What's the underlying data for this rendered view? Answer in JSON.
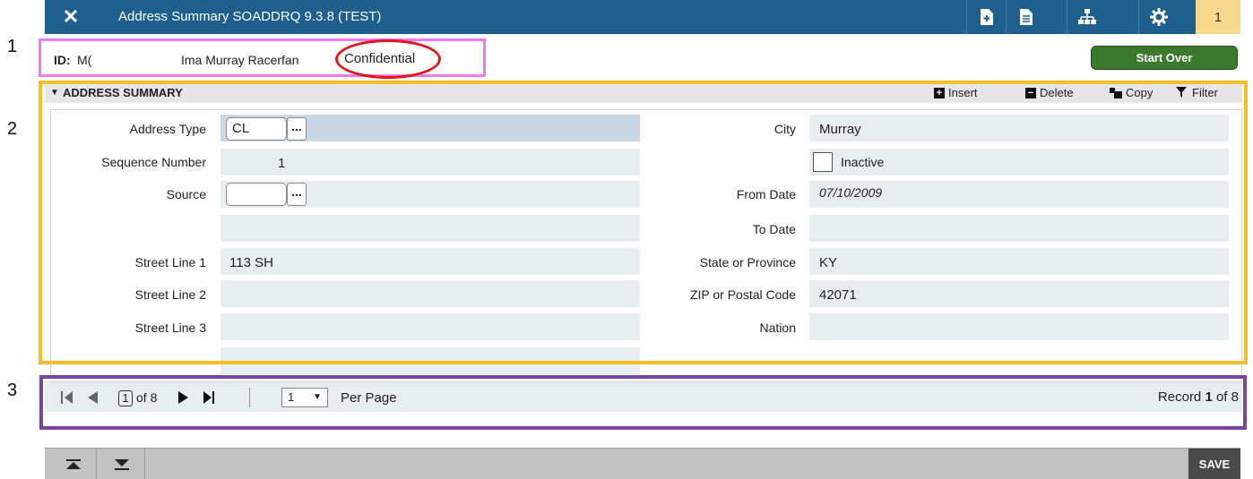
{
  "callouts": [
    "1",
    "2",
    "3"
  ],
  "titlebar": {
    "title": "Address Summary SOADDRQ 9.3.8 (TEST)",
    "icons": [
      "close-icon",
      "add-document-icon",
      "document-icon",
      "related-icon",
      "gear-icon"
    ],
    "notification_count": "1",
    "color": "#1f5f8d"
  },
  "id_row": {
    "id_label": "ID:",
    "id_value": "M(",
    "name": "Ima Murray Racerfan",
    "confidential": "Confidential",
    "start_over": "Start Over"
  },
  "section": {
    "title": "ADDRESS SUMMARY",
    "actions": {
      "insert": "Insert",
      "delete": "Delete",
      "copy": "Copy",
      "filter": "Filter"
    }
  },
  "form": {
    "address_type_label": "Address Type",
    "address_type_value": "CL",
    "sequence_label": "Sequence Number",
    "sequence_value": "1",
    "source_label": "Source",
    "source_value": "",
    "street1_label": "Street Line 1",
    "street1_value": "113  SH",
    "street2_label": "Street Line 2",
    "street3_label": "Street Line 3",
    "city_label": "City",
    "city_value": "Murray",
    "inactive_label": "Inactive",
    "inactive_checked": false,
    "from_date_label": "From Date",
    "from_date_value": "07/10/2009",
    "to_date_label": "To Date",
    "state_label": "State or Province",
    "state_value": "KY",
    "zip_label": "ZIP or Postal Code",
    "zip_value": "42071",
    "nation_label": "Nation",
    "lookup_button": "..."
  },
  "pager": {
    "current_page": "1",
    "of_pages": "of 8",
    "per_page_value": "1",
    "per_page_label": "Per Page",
    "record_prefix": "Record",
    "record_current": "1",
    "record_suffix": "of 8"
  },
  "bottombar": {
    "save": "SAVE"
  }
}
